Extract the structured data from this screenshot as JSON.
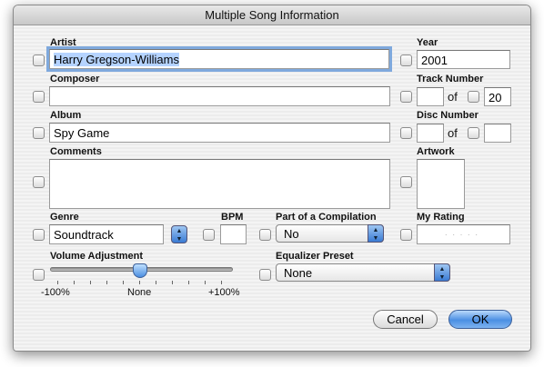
{
  "window": {
    "title": "Multiple Song Information"
  },
  "fields": {
    "artist": {
      "label": "Artist",
      "value": "Harry Gregson-Williams"
    },
    "year": {
      "label": "Year",
      "value": "2001"
    },
    "composer": {
      "label": "Composer",
      "value": ""
    },
    "track": {
      "label": "Track Number",
      "value": "",
      "of": "of",
      "total": "20"
    },
    "album": {
      "label": "Album",
      "value": "Spy Game"
    },
    "disc": {
      "label": "Disc Number",
      "value": "",
      "of": "of",
      "total": ""
    },
    "comments": {
      "label": "Comments",
      "value": ""
    },
    "artwork": {
      "label": "Artwork"
    },
    "genre": {
      "label": "Genre",
      "value": "Soundtrack"
    },
    "bpm": {
      "label": "BPM",
      "value": ""
    },
    "compilation": {
      "label": "Part of a Compilation",
      "value": "No"
    },
    "rating": {
      "label": "My Rating",
      "value": 0,
      "max": 5
    },
    "volume": {
      "label": "Volume Adjustment",
      "value_percent": 0,
      "min_label": "-100%",
      "mid_label": "None",
      "max_label": "+100%"
    },
    "equalizer": {
      "label": "Equalizer Preset",
      "value": "None"
    }
  },
  "buttons": {
    "cancel": "Cancel",
    "ok": "OK"
  },
  "colors": {
    "accent": "#4b8fe3",
    "focus": "#7fa9dd"
  }
}
